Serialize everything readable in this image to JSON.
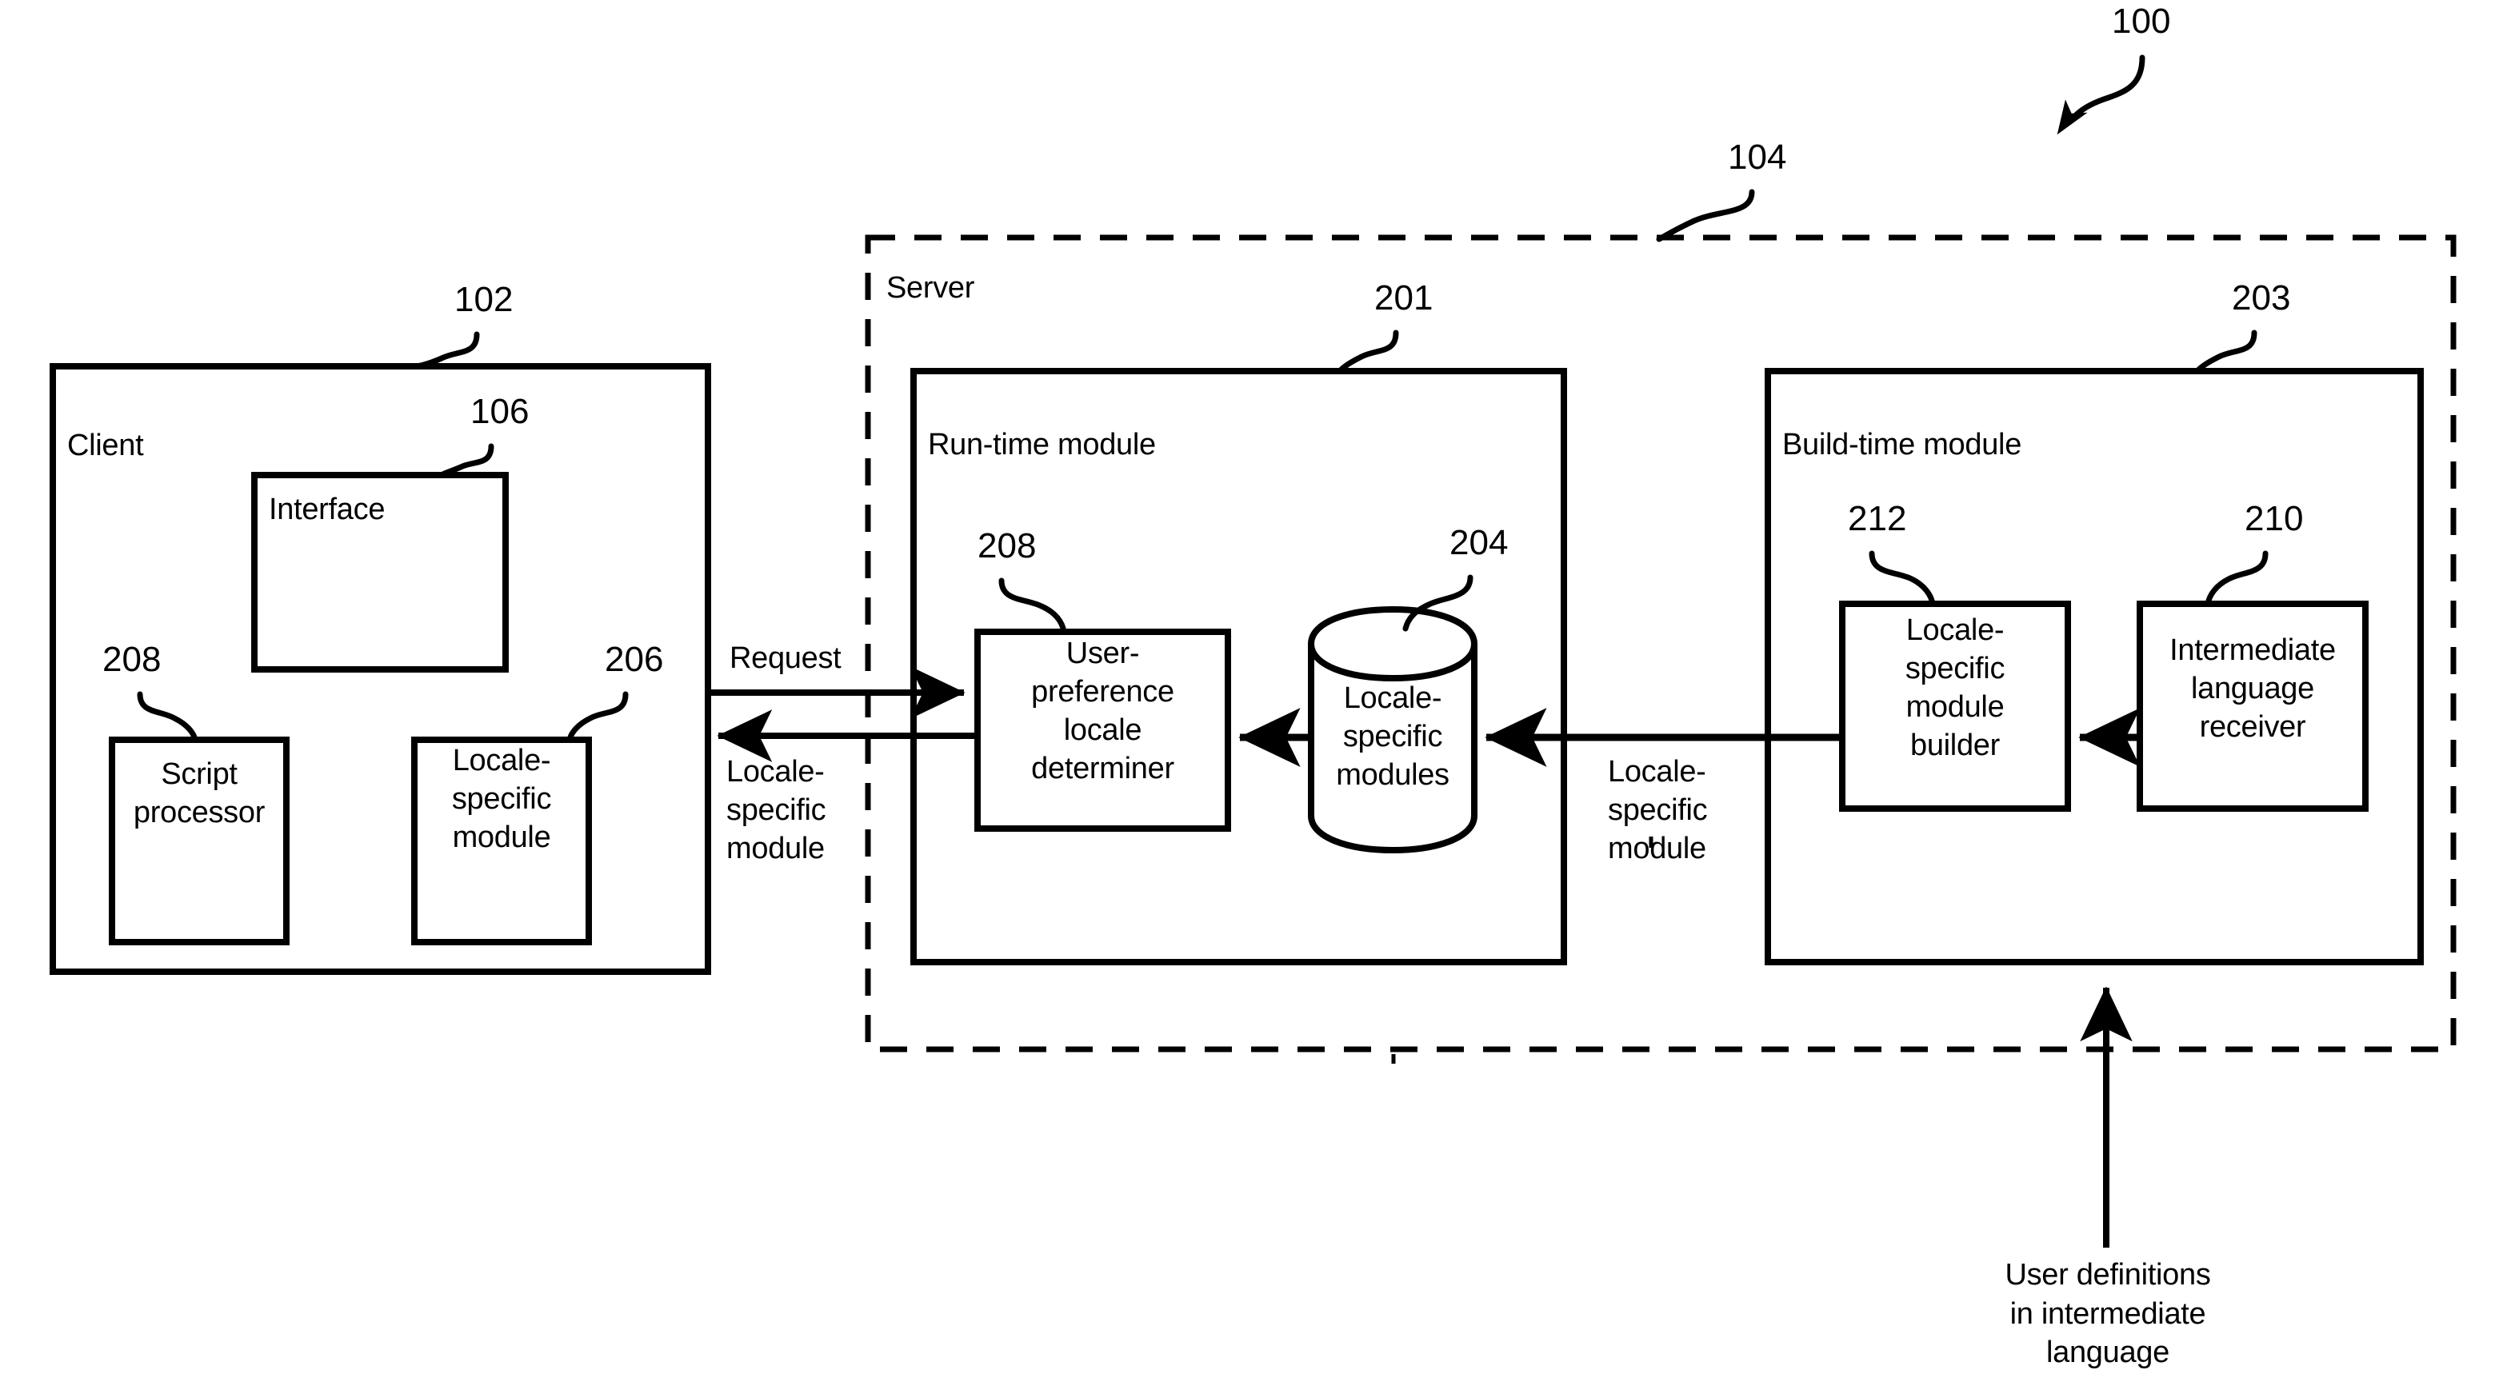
{
  "figure": {
    "system_reference": "100",
    "server_reference": "104"
  },
  "client": {
    "reference": "102",
    "title": "Client",
    "interface": {
      "reference": "106",
      "title": "Interface"
    },
    "script_processor": {
      "reference": "208",
      "label": "Script\nprocessor"
    },
    "locale_specific_module": {
      "reference": "206",
      "label": "Locale-\nspecific\nmodule"
    }
  },
  "server": {
    "title": "Server",
    "reference": "104",
    "runtime_module": {
      "reference": "201",
      "title": "Run-time module",
      "user_preference_locale_determiner": {
        "reference": "208",
        "label": "User-\npreference\nlocale\ndeterminer"
      },
      "locale_specific_modules_store": {
        "reference": "204",
        "label": "Locale-\nspecific\nmodules"
      }
    },
    "buildtime_module": {
      "reference": "203",
      "title": "Build-time module",
      "locale_specific_module_builder": {
        "reference": "212",
        "label": "Locale-\nspecific\nmodule\nbuilder"
      },
      "intermediate_language_receiver": {
        "reference": "210",
        "label": "Intermediate\nlanguage\nreceiver"
      }
    }
  },
  "flows": {
    "request": "Request",
    "client_response": "Locale-\nspecific\nmodule",
    "build_to_runtime": "Locale-\nspecific\nmodule",
    "user_definitions": "User definitions\nin intermediate\nlanguage"
  },
  "colors": {
    "stroke": "#000000",
    "background": "#ffffff"
  }
}
